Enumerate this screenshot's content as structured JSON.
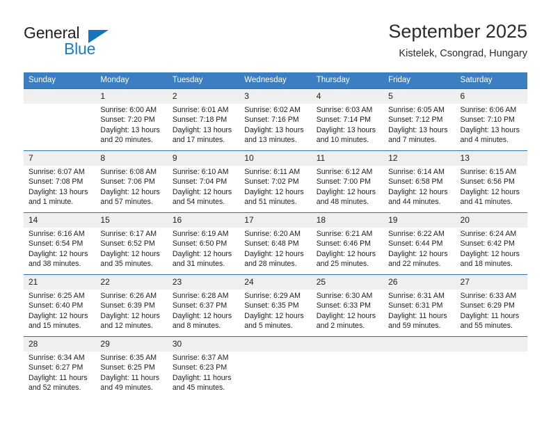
{
  "logo": {
    "word_primary": "General",
    "word_secondary": "Blue",
    "triangle_color": "#1574bb",
    "secondary_color": "#1b7ac4"
  },
  "header": {
    "title": "September 2025",
    "subtitle": "Kistelek, Csongrad, Hungary"
  },
  "theme": {
    "header_bg": "#3b7ec1",
    "row_border": "#2f6fae",
    "daynum_bg": "#efefef"
  },
  "weekday_headers": [
    "Sunday",
    "Monday",
    "Tuesday",
    "Wednesday",
    "Thursday",
    "Friday",
    "Saturday"
  ],
  "weeks": [
    [
      {
        "day": "",
        "sunrise": "",
        "sunset": "",
        "daylight": "",
        "daylight2": ""
      },
      {
        "day": "1",
        "sunrise": "Sunrise: 6:00 AM",
        "sunset": "Sunset: 7:20 PM",
        "daylight": "Daylight: 13 hours",
        "daylight2": "and 20 minutes."
      },
      {
        "day": "2",
        "sunrise": "Sunrise: 6:01 AM",
        "sunset": "Sunset: 7:18 PM",
        "daylight": "Daylight: 13 hours",
        "daylight2": "and 17 minutes."
      },
      {
        "day": "3",
        "sunrise": "Sunrise: 6:02 AM",
        "sunset": "Sunset: 7:16 PM",
        "daylight": "Daylight: 13 hours",
        "daylight2": "and 13 minutes."
      },
      {
        "day": "4",
        "sunrise": "Sunrise: 6:03 AM",
        "sunset": "Sunset: 7:14 PM",
        "daylight": "Daylight: 13 hours",
        "daylight2": "and 10 minutes."
      },
      {
        "day": "5",
        "sunrise": "Sunrise: 6:05 AM",
        "sunset": "Sunset: 7:12 PM",
        "daylight": "Daylight: 13 hours",
        "daylight2": "and 7 minutes."
      },
      {
        "day": "6",
        "sunrise": "Sunrise: 6:06 AM",
        "sunset": "Sunset: 7:10 PM",
        "daylight": "Daylight: 13 hours",
        "daylight2": "and 4 minutes."
      }
    ],
    [
      {
        "day": "7",
        "sunrise": "Sunrise: 6:07 AM",
        "sunset": "Sunset: 7:08 PM",
        "daylight": "Daylight: 13 hours",
        "daylight2": "and 1 minute."
      },
      {
        "day": "8",
        "sunrise": "Sunrise: 6:08 AM",
        "sunset": "Sunset: 7:06 PM",
        "daylight": "Daylight: 12 hours",
        "daylight2": "and 57 minutes."
      },
      {
        "day": "9",
        "sunrise": "Sunrise: 6:10 AM",
        "sunset": "Sunset: 7:04 PM",
        "daylight": "Daylight: 12 hours",
        "daylight2": "and 54 minutes."
      },
      {
        "day": "10",
        "sunrise": "Sunrise: 6:11 AM",
        "sunset": "Sunset: 7:02 PM",
        "daylight": "Daylight: 12 hours",
        "daylight2": "and 51 minutes."
      },
      {
        "day": "11",
        "sunrise": "Sunrise: 6:12 AM",
        "sunset": "Sunset: 7:00 PM",
        "daylight": "Daylight: 12 hours",
        "daylight2": "and 48 minutes."
      },
      {
        "day": "12",
        "sunrise": "Sunrise: 6:14 AM",
        "sunset": "Sunset: 6:58 PM",
        "daylight": "Daylight: 12 hours",
        "daylight2": "and 44 minutes."
      },
      {
        "day": "13",
        "sunrise": "Sunrise: 6:15 AM",
        "sunset": "Sunset: 6:56 PM",
        "daylight": "Daylight: 12 hours",
        "daylight2": "and 41 minutes."
      }
    ],
    [
      {
        "day": "14",
        "sunrise": "Sunrise: 6:16 AM",
        "sunset": "Sunset: 6:54 PM",
        "daylight": "Daylight: 12 hours",
        "daylight2": "and 38 minutes."
      },
      {
        "day": "15",
        "sunrise": "Sunrise: 6:17 AM",
        "sunset": "Sunset: 6:52 PM",
        "daylight": "Daylight: 12 hours",
        "daylight2": "and 35 minutes."
      },
      {
        "day": "16",
        "sunrise": "Sunrise: 6:19 AM",
        "sunset": "Sunset: 6:50 PM",
        "daylight": "Daylight: 12 hours",
        "daylight2": "and 31 minutes."
      },
      {
        "day": "17",
        "sunrise": "Sunrise: 6:20 AM",
        "sunset": "Sunset: 6:48 PM",
        "daylight": "Daylight: 12 hours",
        "daylight2": "and 28 minutes."
      },
      {
        "day": "18",
        "sunrise": "Sunrise: 6:21 AM",
        "sunset": "Sunset: 6:46 PM",
        "daylight": "Daylight: 12 hours",
        "daylight2": "and 25 minutes."
      },
      {
        "day": "19",
        "sunrise": "Sunrise: 6:22 AM",
        "sunset": "Sunset: 6:44 PM",
        "daylight": "Daylight: 12 hours",
        "daylight2": "and 22 minutes."
      },
      {
        "day": "20",
        "sunrise": "Sunrise: 6:24 AM",
        "sunset": "Sunset: 6:42 PM",
        "daylight": "Daylight: 12 hours",
        "daylight2": "and 18 minutes."
      }
    ],
    [
      {
        "day": "21",
        "sunrise": "Sunrise: 6:25 AM",
        "sunset": "Sunset: 6:40 PM",
        "daylight": "Daylight: 12 hours",
        "daylight2": "and 15 minutes."
      },
      {
        "day": "22",
        "sunrise": "Sunrise: 6:26 AM",
        "sunset": "Sunset: 6:39 PM",
        "daylight": "Daylight: 12 hours",
        "daylight2": "and 12 minutes."
      },
      {
        "day": "23",
        "sunrise": "Sunrise: 6:28 AM",
        "sunset": "Sunset: 6:37 PM",
        "daylight": "Daylight: 12 hours",
        "daylight2": "and 8 minutes."
      },
      {
        "day": "24",
        "sunrise": "Sunrise: 6:29 AM",
        "sunset": "Sunset: 6:35 PM",
        "daylight": "Daylight: 12 hours",
        "daylight2": "and 5 minutes."
      },
      {
        "day": "25",
        "sunrise": "Sunrise: 6:30 AM",
        "sunset": "Sunset: 6:33 PM",
        "daylight": "Daylight: 12 hours",
        "daylight2": "and 2 minutes."
      },
      {
        "day": "26",
        "sunrise": "Sunrise: 6:31 AM",
        "sunset": "Sunset: 6:31 PM",
        "daylight": "Daylight: 11 hours",
        "daylight2": "and 59 minutes."
      },
      {
        "day": "27",
        "sunrise": "Sunrise: 6:33 AM",
        "sunset": "Sunset: 6:29 PM",
        "daylight": "Daylight: 11 hours",
        "daylight2": "and 55 minutes."
      }
    ],
    [
      {
        "day": "28",
        "sunrise": "Sunrise: 6:34 AM",
        "sunset": "Sunset: 6:27 PM",
        "daylight": "Daylight: 11 hours",
        "daylight2": "and 52 minutes."
      },
      {
        "day": "29",
        "sunrise": "Sunrise: 6:35 AM",
        "sunset": "Sunset: 6:25 PM",
        "daylight": "Daylight: 11 hours",
        "daylight2": "and 49 minutes."
      },
      {
        "day": "30",
        "sunrise": "Sunrise: 6:37 AM",
        "sunset": "Sunset: 6:23 PM",
        "daylight": "Daylight: 11 hours",
        "daylight2": "and 45 minutes."
      },
      {
        "day": "",
        "sunrise": "",
        "sunset": "",
        "daylight": "",
        "daylight2": ""
      },
      {
        "day": "",
        "sunrise": "",
        "sunset": "",
        "daylight": "",
        "daylight2": ""
      },
      {
        "day": "",
        "sunrise": "",
        "sunset": "",
        "daylight": "",
        "daylight2": ""
      },
      {
        "day": "",
        "sunrise": "",
        "sunset": "",
        "daylight": "",
        "daylight2": ""
      }
    ]
  ]
}
